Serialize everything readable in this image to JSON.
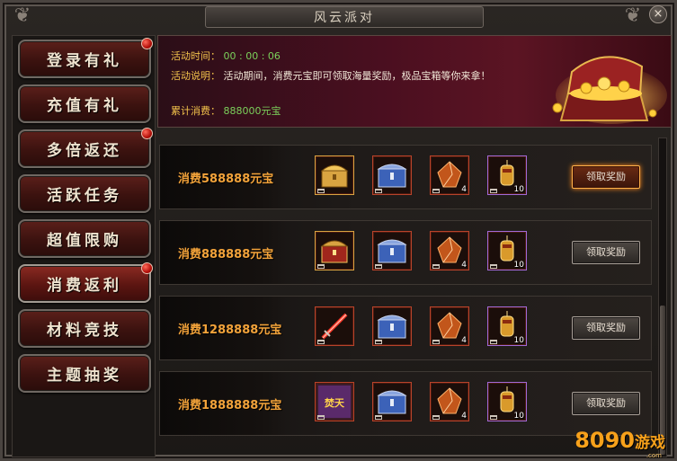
{
  "window": {
    "title": "风云派对",
    "close": "×"
  },
  "sidebar": {
    "items": [
      {
        "label": "登录有礼",
        "badge": true,
        "active": false
      },
      {
        "label": "充值有礼",
        "badge": false,
        "active": false
      },
      {
        "label": "多倍返还",
        "badge": true,
        "active": false
      },
      {
        "label": "活跃任务",
        "badge": false,
        "active": false
      },
      {
        "label": "超值限购",
        "badge": false,
        "active": false
      },
      {
        "label": "消费返利",
        "badge": true,
        "active": true
      },
      {
        "label": "材料竞技",
        "badge": false,
        "active": false
      },
      {
        "label": "主题抽奖",
        "badge": false,
        "active": false
      }
    ]
  },
  "banner": {
    "time_key": "活动时间：",
    "time_value": "00 : 00 : 06",
    "desc_key": "活动说明：",
    "desc_value": "活动期间，消费元宝即可领取海量奖励，极品宝箱等你来拿！",
    "total_key": "累计消费：",
    "total_value": "888000元宝"
  },
  "rewards": {
    "claim_label": "领取奖励",
    "rows": [
      {
        "cost": "消费588888元宝",
        "items": [
          {
            "icon": "golden-chest-icon",
            "qty": ""
          },
          {
            "icon": "silver-chest-icon",
            "qty": ""
          },
          {
            "icon": "orange-gem-icon",
            "qty": "4"
          },
          {
            "icon": "lantern-scroll-icon",
            "qty": "10"
          }
        ],
        "highlight": true
      },
      {
        "cost": "消费888888元宝",
        "items": [
          {
            "icon": "red-gold-chest-icon",
            "qty": ""
          },
          {
            "icon": "silver-chest-icon",
            "qty": ""
          },
          {
            "icon": "orange-gem-icon",
            "qty": "4"
          },
          {
            "icon": "lantern-scroll-icon",
            "qty": "10"
          }
        ],
        "highlight": false
      },
      {
        "cost": "消费1288888元宝",
        "items": [
          {
            "icon": "red-sword-icon",
            "qty": ""
          },
          {
            "icon": "silver-chest-icon",
            "qty": ""
          },
          {
            "icon": "orange-gem-icon",
            "qty": "4"
          },
          {
            "icon": "lantern-scroll-icon",
            "qty": "10"
          }
        ],
        "highlight": false
      },
      {
        "cost": "消费1888888元宝",
        "items": [
          {
            "icon": "fentian-title-icon",
            "qty": ""
          },
          {
            "icon": "silver-chest-icon",
            "qty": ""
          },
          {
            "icon": "orange-gem-icon",
            "qty": "4"
          },
          {
            "icon": "lantern-scroll-icon",
            "qty": "10"
          }
        ],
        "highlight": false
      }
    ]
  },
  "title_badge_text": "焚天",
  "watermark": {
    "main": "8090",
    "suffix": "游戏",
    "sub": ".com"
  },
  "colors": {
    "accent_gold": "#f3a33a",
    "timer_green": "#7bd15b",
    "button_glow": "#ff8a1e"
  }
}
